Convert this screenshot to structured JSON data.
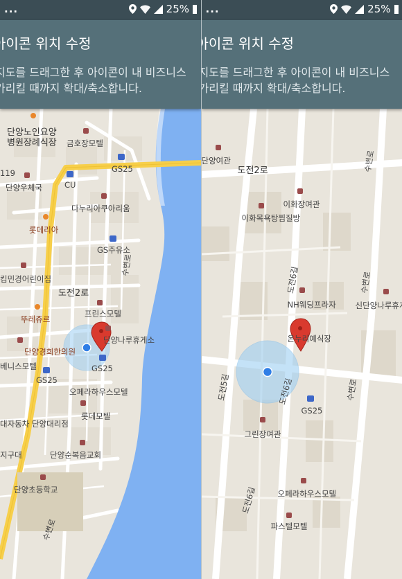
{
  "status_bar": {
    "left_dots": "...",
    "battery_text": "25%",
    "icons": [
      "location-icon",
      "wifi-icon",
      "signal-icon",
      "battery-icon"
    ]
  },
  "app": {
    "title": "아이콘 위치 수정",
    "instruction_line1": "지도를 드래그한 후 아이콘이 내 비즈니스",
    "instruction_line2": "가리킬 때까지 확대/축소합니다."
  },
  "left_map": {
    "labels": [
      {
        "key": "l1",
        "text": "단양노인요양"
      },
      {
        "key": "l2",
        "text": "병원장례식장"
      },
      {
        "key": "l3",
        "text": "금호장모텔"
      },
      {
        "key": "l4",
        "text": "GS25"
      },
      {
        "key": "l5",
        "text": "119"
      },
      {
        "key": "l6",
        "text": "단양우체국"
      },
      {
        "key": "l7",
        "text": "CU"
      },
      {
        "key": "l8",
        "text": "다누리아쿠아리움"
      },
      {
        "key": "l9",
        "text": "롯데리아"
      },
      {
        "key": "l10",
        "text": "GS주유소"
      },
      {
        "key": "l11",
        "text": "킴민경어린이집"
      },
      {
        "key": "l12",
        "text": "도전2로"
      },
      {
        "key": "l13",
        "text": "뚜레쥬르"
      },
      {
        "key": "l14",
        "text": "프린스모텔"
      },
      {
        "key": "l15",
        "text": "단양경희한의원"
      },
      {
        "key": "l16",
        "text": "단양나루휴게소"
      },
      {
        "key": "l17",
        "text": "GS25"
      },
      {
        "key": "l18",
        "text": "베니스모텔"
      },
      {
        "key": "l19",
        "text": "GS25"
      },
      {
        "key": "l20",
        "text": "오페라하우스모텔"
      },
      {
        "key": "l21",
        "text": "롯데모텔"
      },
      {
        "key": "l22",
        "text": "대자동차 단양대리점"
      },
      {
        "key": "l23",
        "text": "단양순복음교회"
      },
      {
        "key": "l24",
        "text": "지구대"
      },
      {
        "key": "l25",
        "text": "단양초등학교"
      },
      {
        "key": "l26",
        "text": "수변로"
      },
      {
        "key": "l27",
        "text": "수변로"
      }
    ]
  },
  "right_map": {
    "labels": [
      {
        "key": "r1",
        "text": "단양여관"
      },
      {
        "key": "r2",
        "text": "도전2로"
      },
      {
        "key": "r3",
        "text": "수변로"
      },
      {
        "key": "r4",
        "text": "이화장여관"
      },
      {
        "key": "r5",
        "text": "이화목욕탕찜질방"
      },
      {
        "key": "r6",
        "text": "도전6길"
      },
      {
        "key": "r7",
        "text": "수변로"
      },
      {
        "key": "r8",
        "text": "신단양나루휴게"
      },
      {
        "key": "r9",
        "text": "NH웨딩프라자"
      },
      {
        "key": "r10",
        "text": "온누리예식장"
      },
      {
        "key": "r11",
        "text": "도전5길"
      },
      {
        "key": "r12",
        "text": "도전6길"
      },
      {
        "key": "r13",
        "text": "수변로"
      },
      {
        "key": "r14",
        "text": "GS25"
      },
      {
        "key": "r15",
        "text": "그린장여관"
      },
      {
        "key": "r16",
        "text": "도전6길"
      },
      {
        "key": "r17",
        "text": "오페라하우스모텔"
      },
      {
        "key": "r18",
        "text": "파스텔모텔"
      }
    ]
  },
  "colors": {
    "status_bar": "#3b4d55",
    "app_bar": "#557079",
    "map_land": "#e9e5dc",
    "water": "#7fb1f2",
    "major_road": "#f7cf4a",
    "pin": "#d93a2e",
    "location_dot": "#2f7ee6"
  }
}
